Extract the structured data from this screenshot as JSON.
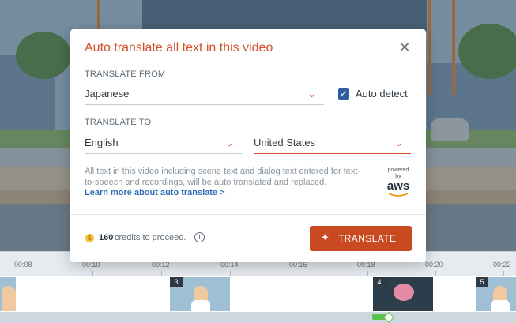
{
  "modal": {
    "title": "Auto translate all text in this video",
    "translate_from_label": "TRANSLATE FROM",
    "source_language": "Japanese",
    "auto_detect_label": "Auto detect",
    "auto_detect_checked": true,
    "translate_to_label": "TRANSLATE TO",
    "target_language": "English",
    "target_region": "United States",
    "description": "All text in this video including scene text and dialog text entered for text-to-speech and recordings, will be auto translated and replaced.",
    "learn_more_link": "Learn more about auto translate >",
    "powered_by": "powered by",
    "provider_logo": "aws",
    "credits_count": "160",
    "credits_text": "credits to proceed.",
    "translate_button": "TRANSLATE",
    "icons": {
      "close": "close-icon",
      "chevron": "chevron-down-icon",
      "check": "check-icon",
      "coin": "coin-icon",
      "info": "info-icon",
      "sparkle": "sparkle-icon"
    },
    "colors": {
      "accent": "#d2502a",
      "button": "#c94a20",
      "link": "#2e6fb6",
      "checkbox": "#2f5f9e"
    }
  },
  "timeline": {
    "ticks": [
      "00:08",
      "00:10",
      "00:12",
      "00:14",
      "00:16",
      "00:18",
      "00:20",
      "00:22"
    ],
    "scenes": [
      "3",
      "4",
      "5"
    ]
  }
}
